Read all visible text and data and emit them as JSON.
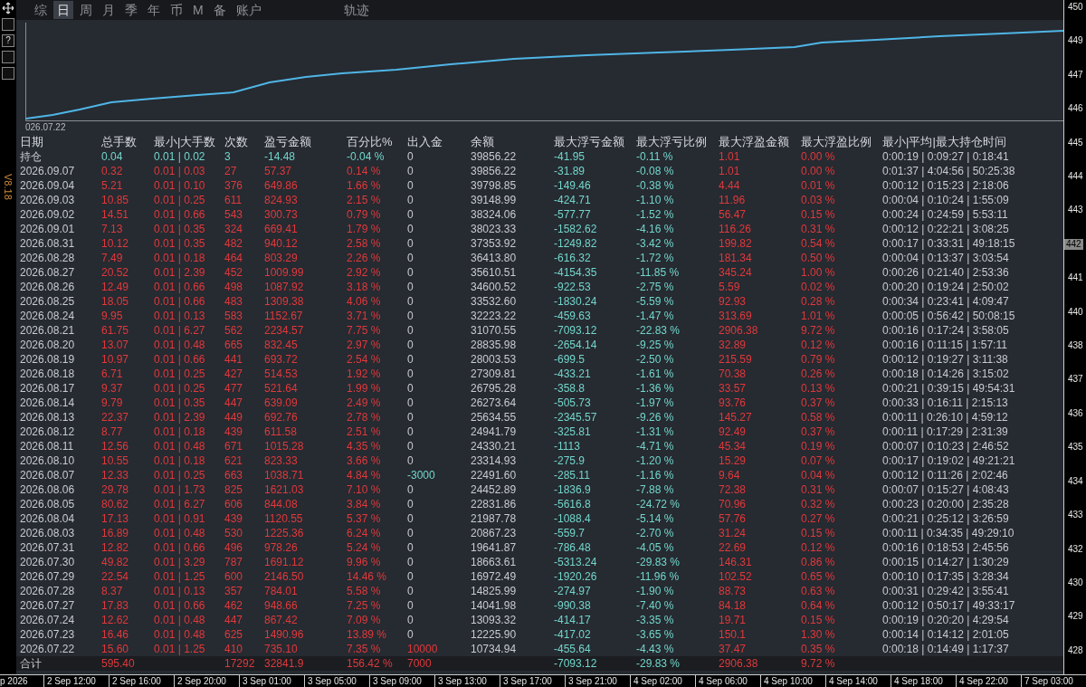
{
  "side_strip": {
    "help_label": "?",
    "version": "V8.18"
  },
  "toolbar": {
    "tabs": [
      {
        "label": "综",
        "selected": false
      },
      {
        "label": "日",
        "selected": true
      },
      {
        "label": "周",
        "selected": false
      },
      {
        "label": "月",
        "selected": false
      },
      {
        "label": "季",
        "selected": false
      },
      {
        "label": "年",
        "selected": false
      },
      {
        "label": "币",
        "selected": false
      },
      {
        "label": "M",
        "selected": false
      },
      {
        "label": "备",
        "selected": false
      },
      {
        "label": "账户",
        "selected": false
      },
      {
        "label": "轨迹",
        "selected": false
      }
    ]
  },
  "equity_chart": {
    "start_label": "026.07.22"
  },
  "table": {
    "columns": [
      "日期",
      "总手数",
      "最小|大手数",
      "次数",
      "盈亏金额",
      "百分比%",
      "出入金",
      "余额",
      "最大浮亏金额",
      "最大浮亏比例",
      "最大浮盈金额",
      "最大浮盈比例",
      "最小|平均|最大持仓时间"
    ],
    "rows": [
      {
        "kind": "position",
        "deposit": false,
        "withdrawal": false,
        "cells": [
          "持仓",
          "0.04",
          "0.01 | 0.02",
          "3",
          "-14.48",
          "-0.04 %",
          "0",
          "39856.22",
          "-41.95",
          "-0.11 %",
          "1.01",
          "0.00 %",
          "0:00:19 | 0:09:27 | 0:18:41"
        ]
      },
      {
        "kind": "day",
        "deposit": false,
        "withdrawal": false,
        "cells": [
          "2026.09.07",
          "0.32",
          "0.01 | 0.03",
          "27",
          "57.37",
          "0.14 %",
          "0",
          "39856.22",
          "-31.89",
          "-0.08 %",
          "1.01",
          "0.00 %",
          "0:01:37 | 4:04:56 | 50:25:38"
        ]
      },
      {
        "kind": "day",
        "deposit": false,
        "withdrawal": false,
        "cells": [
          "2026.09.04",
          "5.21",
          "0.01 | 0.10",
          "376",
          "649.86",
          "1.66 %",
          "0",
          "39798.85",
          "-149.46",
          "-0.38 %",
          "4.44",
          "0.01 %",
          "0:00:12 | 0:15:23 | 2:18:06"
        ]
      },
      {
        "kind": "day",
        "deposit": false,
        "withdrawal": false,
        "cells": [
          "2026.09.03",
          "10.85",
          "0.01 | 0.25",
          "611",
          "824.93",
          "2.15 %",
          "0",
          "39148.99",
          "-424.71",
          "-1.10 %",
          "11.96",
          "0.03 %",
          "0:00:04 | 0:10:24 | 1:55:09"
        ]
      },
      {
        "kind": "day",
        "deposit": false,
        "withdrawal": false,
        "cells": [
          "2026.09.02",
          "14.51",
          "0.01 | 0.66",
          "543",
          "300.73",
          "0.79 %",
          "0",
          "38324.06",
          "-577.77",
          "-1.52 %",
          "56.47",
          "0.15 %",
          "0:00:24 | 0:24:59 | 5:53:11"
        ]
      },
      {
        "kind": "day",
        "deposit": false,
        "withdrawal": false,
        "cells": [
          "2026.09.01",
          "7.13",
          "0.01 | 0.35",
          "324",
          "669.41",
          "1.79 %",
          "0",
          "38023.33",
          "-1582.62",
          "-4.16 %",
          "116.26",
          "0.31 %",
          "0:00:12 | 0:22:21 | 3:08:25"
        ]
      },
      {
        "kind": "day",
        "deposit": false,
        "withdrawal": false,
        "cells": [
          "2026.08.31",
          "10.12",
          "0.01 | 0.35",
          "482",
          "940.12",
          "2.58 %",
          "0",
          "37353.92",
          "-1249.82",
          "-3.42 %",
          "199.82",
          "0.54 %",
          "0:00:17 | 0:33:31 | 49:18:15"
        ]
      },
      {
        "kind": "day",
        "deposit": false,
        "withdrawal": false,
        "cells": [
          "2026.08.28",
          "7.49",
          "0.01 | 0.18",
          "464",
          "803.29",
          "2.26 %",
          "0",
          "36413.80",
          "-616.32",
          "-1.72 %",
          "181.34",
          "0.50 %",
          "0:00:04 | 0:13:37 | 3:03:54"
        ]
      },
      {
        "kind": "day",
        "deposit": false,
        "withdrawal": false,
        "cells": [
          "2026.08.27",
          "20.52",
          "0.01 | 2.39",
          "452",
          "1009.99",
          "2.92 %",
          "0",
          "35610.51",
          "-4154.35",
          "-11.85 %",
          "345.24",
          "1.00 %",
          "0:00:26 | 0:21:40 | 2:53:36"
        ]
      },
      {
        "kind": "day",
        "deposit": false,
        "withdrawal": false,
        "cells": [
          "2026.08.26",
          "12.49",
          "0.01 | 0.66",
          "498",
          "1087.92",
          "3.18 %",
          "0",
          "34600.52",
          "-922.53",
          "-2.75 %",
          "5.59",
          "0.02 %",
          "0:00:20 | 0:19:24 | 2:50:02"
        ]
      },
      {
        "kind": "day",
        "deposit": false,
        "withdrawal": false,
        "cells": [
          "2026.08.25",
          "18.05",
          "0.01 | 0.66",
          "483",
          "1309.38",
          "4.06 %",
          "0",
          "33532.60",
          "-1830.24",
          "-5.59 %",
          "92.93",
          "0.28 %",
          "0:00:34 | 0:23:41 | 4:09:47"
        ]
      },
      {
        "kind": "day",
        "deposit": false,
        "withdrawal": false,
        "cells": [
          "2026.08.24",
          "9.95",
          "0.01 | 0.13",
          "583",
          "1152.67",
          "3.71 %",
          "0",
          "32223.22",
          "-459.63",
          "-1.47 %",
          "313.69",
          "1.01 %",
          "0:00:05 | 0:56:42 | 50:08:15"
        ]
      },
      {
        "kind": "day",
        "deposit": false,
        "withdrawal": false,
        "cells": [
          "2026.08.21",
          "61.75",
          "0.01 | 6.27",
          "562",
          "2234.57",
          "7.75 %",
          "0",
          "31070.55",
          "-7093.12",
          "-22.83 %",
          "2906.38",
          "9.72 %",
          "0:00:16 | 0:17:24 | 3:58:05"
        ]
      },
      {
        "kind": "day",
        "deposit": false,
        "withdrawal": false,
        "cells": [
          "2026.08.20",
          "13.07",
          "0.01 | 0.48",
          "665",
          "832.45",
          "2.97 %",
          "0",
          "28835.98",
          "-2654.14",
          "-9.25 %",
          "32.89",
          "0.12 %",
          "0:00:16 | 0:11:15 | 1:57:11"
        ]
      },
      {
        "kind": "day",
        "deposit": false,
        "withdrawal": false,
        "cells": [
          "2026.08.19",
          "10.97",
          "0.01 | 0.66",
          "441",
          "693.72",
          "2.54 %",
          "0",
          "28003.53",
          "-699.5",
          "-2.50 %",
          "215.59",
          "0.79 %",
          "0:00:12 | 0:19:27 | 3:11:38"
        ]
      },
      {
        "kind": "day",
        "deposit": false,
        "withdrawal": false,
        "cells": [
          "2026.08.18",
          "6.71",
          "0.01 | 0.25",
          "427",
          "514.53",
          "1.92 %",
          "0",
          "27309.81",
          "-433.21",
          "-1.61 %",
          "70.38",
          "0.26 %",
          "0:00:18 | 0:14:26 | 3:15:02"
        ]
      },
      {
        "kind": "day",
        "deposit": false,
        "withdrawal": false,
        "cells": [
          "2026.08.17",
          "9.37",
          "0.01 | 0.25",
          "477",
          "521.64",
          "1.99 %",
          "0",
          "26795.28",
          "-358.8",
          "-1.36 %",
          "33.57",
          "0.13 %",
          "0:00:21 | 0:39:15 | 49:54:31"
        ]
      },
      {
        "kind": "day",
        "deposit": false,
        "withdrawal": false,
        "cells": [
          "2026.08.14",
          "9.79",
          "0.01 | 0.35",
          "447",
          "639.09",
          "2.49 %",
          "0",
          "26273.64",
          "-505.73",
          "-1.97 %",
          "93.76",
          "0.37 %",
          "0:00:33 | 0:16:11 | 2:15:13"
        ]
      },
      {
        "kind": "day",
        "deposit": false,
        "withdrawal": false,
        "cells": [
          "2026.08.13",
          "22.37",
          "0.01 | 2.39",
          "449",
          "692.76",
          "2.78 %",
          "0",
          "25634.55",
          "-2345.57",
          "-9.26 %",
          "145.27",
          "0.58 %",
          "0:00:11 | 0:26:10 | 4:59:12"
        ]
      },
      {
        "kind": "day",
        "deposit": false,
        "withdrawal": false,
        "cells": [
          "2026.08.12",
          "8.77",
          "0.01 | 0.18",
          "439",
          "611.58",
          "2.51 %",
          "0",
          "24941.79",
          "-325.81",
          "-1.31 %",
          "92.49",
          "0.37 %",
          "0:00:11 | 0:17:29 | 2:31:39"
        ]
      },
      {
        "kind": "day",
        "deposit": false,
        "withdrawal": false,
        "cells": [
          "2026.08.11",
          "12.56",
          "0.01 | 0.48",
          "671",
          "1015.28",
          "4.35 %",
          "0",
          "24330.21",
          "-1113",
          "-4.71 %",
          "45.34",
          "0.19 %",
          "0:00:07 | 0:10:23 | 2:46:52"
        ]
      },
      {
        "kind": "day",
        "deposit": false,
        "withdrawal": false,
        "cells": [
          "2026.08.10",
          "10.55",
          "0.01 | 0.18",
          "621",
          "823.33",
          "3.66 %",
          "0",
          "23314.93",
          "-275.9",
          "-1.20 %",
          "15.29",
          "0.07 %",
          "0:00:17 | 0:19:02 | 49:21:21"
        ]
      },
      {
        "kind": "day",
        "deposit": false,
        "withdrawal": true,
        "cells": [
          "2026.08.07",
          "12.33",
          "0.01 | 0.25",
          "663",
          "1038.71",
          "4.84 %",
          "-3000",
          "22491.60",
          "-285.11",
          "-1.16 %",
          "9.64",
          "0.04 %",
          "0:00:12 | 0:11:26 | 2:02:46"
        ]
      },
      {
        "kind": "day",
        "deposit": false,
        "withdrawal": false,
        "cells": [
          "2026.08.06",
          "29.78",
          "0.01 | 1.73",
          "825",
          "1621.03",
          "7.10 %",
          "0",
          "24452.89",
          "-1836.9",
          "-7.88 %",
          "72.38",
          "0.31 %",
          "0:00:07 | 0:15:27 | 4:08:43"
        ]
      },
      {
        "kind": "day",
        "deposit": false,
        "withdrawal": false,
        "cells": [
          "2026.08.05",
          "80.62",
          "0.01 | 6.27",
          "606",
          "844.08",
          "3.84 %",
          "0",
          "22831.86",
          "-5616.8",
          "-24.72 %",
          "70.96",
          "0.32 %",
          "0:00:23 | 0:20:00 | 2:35:28"
        ]
      },
      {
        "kind": "day",
        "deposit": false,
        "withdrawal": false,
        "cells": [
          "2026.08.04",
          "17.13",
          "0.01 | 0.91",
          "439",
          "1120.55",
          "5.37 %",
          "0",
          "21987.78",
          "-1088.4",
          "-5.14 %",
          "57.76",
          "0.27 %",
          "0:00:21 | 0:25:12 | 3:26:59"
        ]
      },
      {
        "kind": "day",
        "deposit": false,
        "withdrawal": false,
        "cells": [
          "2026.08.03",
          "16.89",
          "0.01 | 0.48",
          "530",
          "1225.36",
          "6.24 %",
          "0",
          "20867.23",
          "-559.7",
          "-2.70 %",
          "31.24",
          "0.15 %",
          "0:00:11 | 0:34:35 | 49:29:10"
        ]
      },
      {
        "kind": "day",
        "deposit": false,
        "withdrawal": false,
        "cells": [
          "2026.07.31",
          "12.82",
          "0.01 | 0.66",
          "496",
          "978.26",
          "5.24 %",
          "0",
          "19641.87",
          "-786.48",
          "-4.05 %",
          "22.69",
          "0.12 %",
          "0:00:16 | 0:18:53 | 2:45:56"
        ]
      },
      {
        "kind": "day",
        "deposit": false,
        "withdrawal": false,
        "cells": [
          "2026.07.30",
          "49.82",
          "0.01 | 3.29",
          "787",
          "1691.12",
          "9.96 %",
          "0",
          "18663.61",
          "-5313.24",
          "-29.83 %",
          "146.31",
          "0.86 %",
          "0:00:15 | 0:14:27 | 1:30:29"
        ]
      },
      {
        "kind": "day",
        "deposit": false,
        "withdrawal": false,
        "cells": [
          "2026.07.29",
          "22.54",
          "0.01 | 1.25",
          "600",
          "2146.50",
          "14.46 %",
          "0",
          "16972.49",
          "-1920.26",
          "-11.96 %",
          "102.52",
          "0.65 %",
          "0:00:10 | 0:17:35 | 3:28:34"
        ]
      },
      {
        "kind": "day",
        "deposit": false,
        "withdrawal": false,
        "cells": [
          "2026.07.28",
          "8.37",
          "0.01 | 0.13",
          "357",
          "784.01",
          "5.58 %",
          "0",
          "14825.99",
          "-274.97",
          "-1.90 %",
          "88.73",
          "0.63 %",
          "0:00:31 | 0:29:42 | 3:55:41"
        ]
      },
      {
        "kind": "day",
        "deposit": false,
        "withdrawal": false,
        "cells": [
          "2026.07.27",
          "17.83",
          "0.01 | 0.66",
          "462",
          "948.66",
          "7.25 %",
          "0",
          "14041.98",
          "-990.38",
          "-7.40 %",
          "84.18",
          "0.64 %",
          "0:00:12 | 0:50:17 | 49:33:17"
        ]
      },
      {
        "kind": "day",
        "deposit": false,
        "withdrawal": false,
        "cells": [
          "2026.07.24",
          "12.62",
          "0.01 | 0.48",
          "447",
          "867.42",
          "7.09 %",
          "0",
          "13093.32",
          "-414.17",
          "-3.35 %",
          "19.71",
          "0.15 %",
          "0:00:19 | 0:20:20 | 4:29:54"
        ]
      },
      {
        "kind": "day",
        "deposit": false,
        "withdrawal": false,
        "cells": [
          "2026.07.23",
          "16.46",
          "0.01 | 0.48",
          "625",
          "1490.96",
          "13.89 %",
          "0",
          "12225.90",
          "-417.02",
          "-3.65 %",
          "150.1",
          "1.30 %",
          "0:00:14 | 0:14:12 | 2:01:05"
        ]
      },
      {
        "kind": "day",
        "deposit": true,
        "withdrawal": false,
        "cells": [
          "2026.07.22",
          "15.60",
          "0.01 | 1.25",
          "410",
          "735.10",
          "7.35 %",
          "10000",
          "10734.94",
          "-455.64",
          "-4.43 %",
          "37.47",
          "0.35 %",
          "0:00:18 | 0:14:49 | 1:17:37"
        ]
      },
      {
        "kind": "total",
        "deposit": true,
        "withdrawal": false,
        "cells": [
          "合计",
          "595.40",
          null,
          "17292",
          "32841.9",
          "156.42 %",
          "7000",
          null,
          "-7093.12",
          "-29.83 %",
          "2906.38",
          "9.72 %",
          null
        ]
      }
    ]
  },
  "price_axis": [
    {
      "label": "450",
      "highlighted": false
    },
    {
      "label": "449",
      "highlighted": false
    },
    {
      "label": "447",
      "highlighted": false
    },
    {
      "label": "446",
      "highlighted": false
    },
    {
      "label": "445",
      "highlighted": false
    },
    {
      "label": "444",
      "highlighted": false
    },
    {
      "label": "443",
      "highlighted": false
    },
    {
      "label": "442",
      "highlighted": true
    },
    {
      "label": "441",
      "highlighted": false
    },
    {
      "label": "440",
      "highlighted": false
    },
    {
      "label": "438",
      "highlighted": false
    },
    {
      "label": "437",
      "highlighted": false
    },
    {
      "label": "436",
      "highlighted": false
    },
    {
      "label": "435",
      "highlighted": false
    },
    {
      "label": "434",
      "highlighted": false
    },
    {
      "label": "433",
      "highlighted": false
    },
    {
      "label": "432",
      "highlighted": false
    },
    {
      "label": "430",
      "highlighted": false
    },
    {
      "label": "429",
      "highlighted": false
    },
    {
      "label": "428",
      "highlighted": false
    }
  ],
  "time_axis": [
    "p 2026",
    "2 Sep 12:00",
    "2 Sep 16:00",
    "2 Sep 20:00",
    "3 Sep 01:00",
    "3 Sep 05:00",
    "3 Sep 09:00",
    "3 Sep 13:00",
    "3 Sep 17:00",
    "3 Sep 21:00",
    "4 Sep 02:00",
    "4 Sep 06:00",
    "4 Sep 10:00",
    "4 Sep 14:00",
    "4 Sep 18:00",
    "4 Sep 22:00",
    "7 Sep 03:00"
  ]
}
